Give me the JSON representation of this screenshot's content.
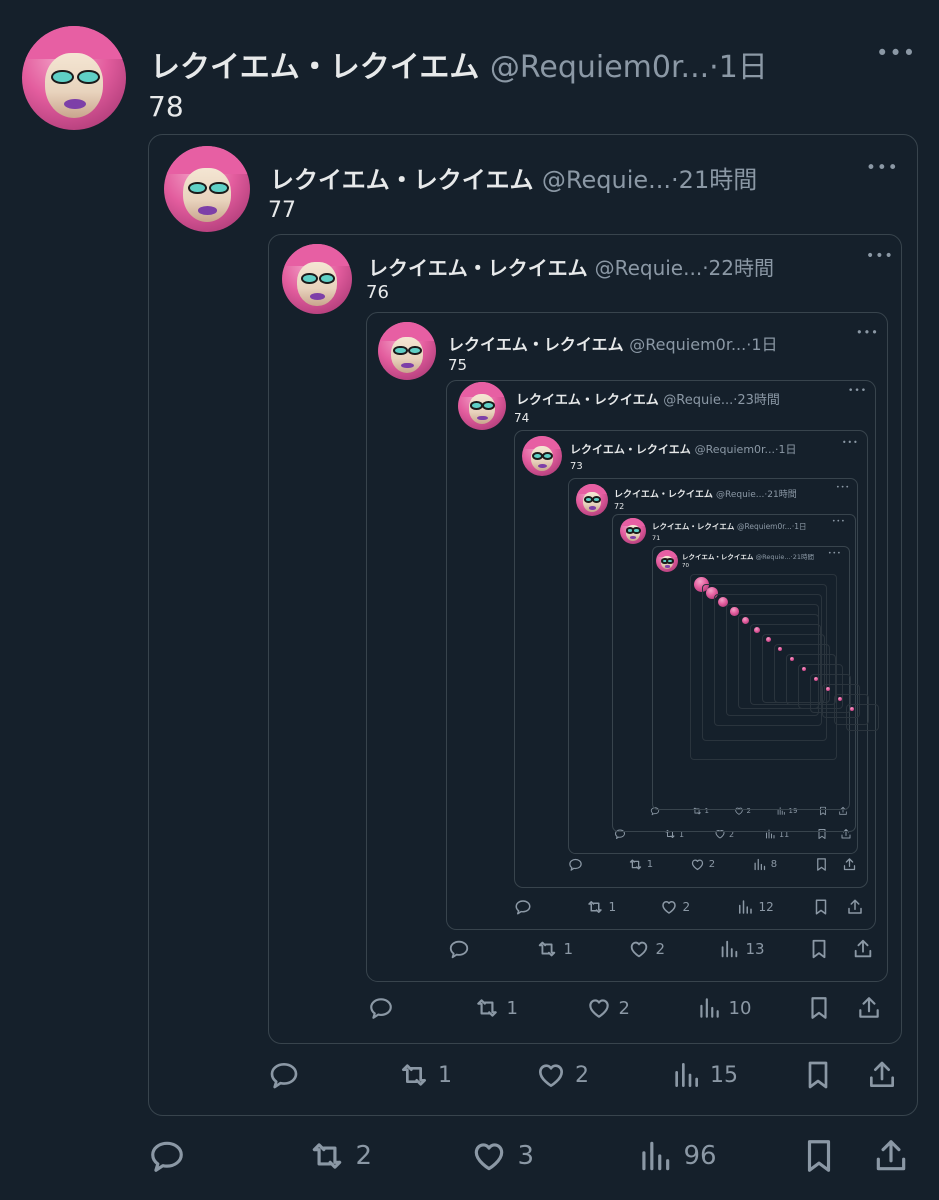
{
  "posts": [
    {
      "name": "レクイエム・レクイエム",
      "handle": "@Requiem0r...",
      "time": "1日",
      "text": "78",
      "replies": "",
      "reposts": "2",
      "likes": "3",
      "views": "96"
    },
    {
      "name": "レクイエム・レクイエム",
      "handle": "@Requie...",
      "time": "21時間",
      "text": "77",
      "replies": "",
      "reposts": "1",
      "likes": "2",
      "views": "15"
    },
    {
      "name": "レクイエム・レクイエム",
      "handle": "@Requie...",
      "time": "22時間",
      "text": "76",
      "replies": "",
      "reposts": "1",
      "likes": "2",
      "views": "10"
    },
    {
      "name": "レクイエム・レクイエム",
      "handle": "@Requiem0r...",
      "time": "1日",
      "text": "75",
      "replies": "",
      "reposts": "1",
      "likes": "2",
      "views": "13"
    },
    {
      "name": "レクイエム・レクイエム",
      "handle": "@Requie...",
      "time": "23時間",
      "text": "74",
      "replies": "",
      "reposts": "1",
      "likes": "2",
      "views": "12"
    },
    {
      "name": "レクイエム・レクイエム",
      "handle": "@Requiem0r...",
      "time": "1日",
      "text": "73",
      "replies": "",
      "reposts": "1",
      "likes": "2",
      "views": "8"
    },
    {
      "name": "レクイエム・レクイエム",
      "handle": "@Requie...",
      "time": "21時間",
      "text": "72",
      "replies": "",
      "reposts": "1",
      "likes": "2",
      "views": "11"
    },
    {
      "name": "レクイエム・レクイエム",
      "handle": "@Requiem0r...",
      "time": "1日",
      "text": "71",
      "replies": "",
      "reposts": "1",
      "likes": "2",
      "views": "19"
    },
    {
      "name": "レクイエム・レクイエム",
      "handle": "@Requie...",
      "time": "21時間",
      "text": "70",
      "replies": "",
      "reposts": "",
      "likes": "",
      "views": ""
    }
  ],
  "more_label": "•••",
  "separator": "·"
}
